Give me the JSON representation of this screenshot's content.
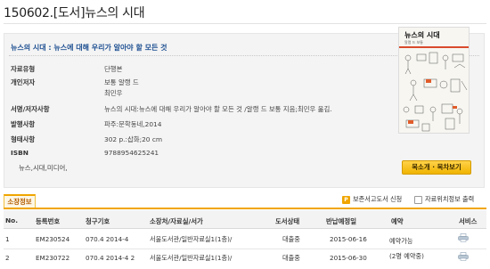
{
  "page_title": "150602.[도서]뉴스의 시대",
  "record": {
    "title": "뉴스의 시대 : 뉴스에 대해 우리가 알아야 할 모든 것",
    "fields": [
      {
        "label": "자료유형",
        "value": "단행본"
      },
      {
        "label": "개인저자",
        "value": "보통 알랭 드"
      },
      {
        "label": "",
        "value": "최민우"
      },
      {
        "label": "서명/저자사항",
        "value": "뉴스의 시대:뉴스에 대해 우리가 알아야 할 모든 것 /알랭 드 보통 지음;최민우 옮김."
      },
      {
        "label": "발행사항",
        "value": "파주:문학동네,2014"
      },
      {
        "label": "형태사항",
        "value": "302 p.:삽화;20 cm"
      },
      {
        "label": "ISBN",
        "value": "9788954625241"
      }
    ],
    "keywords": "뉴스,시대,미디어,",
    "cover": {
      "title": "뉴스의 시대",
      "subtitle": "알랭 드 보통"
    },
    "preview_button": "목소개 · 목차보기"
  },
  "holdings": {
    "tab_label": "소장정보",
    "tools": {
      "storage_request": "보존서고도서 신청",
      "location_print": "자료위치정보 출력"
    },
    "columns": [
      "No.",
      "등록번호",
      "청구기호",
      "소장처/자료실/서가",
      "도서상태",
      "반납예정일",
      "예약",
      "서비스"
    ],
    "rows": [
      {
        "no": "1",
        "reg": "EM230524",
        "call": "070.4 2014-4",
        "location": "서울도서관/일반자료실1(1층)/",
        "status": "대출중",
        "due": "2015-06-16",
        "reserve": "예약가능",
        "reserve2": ""
      },
      {
        "no": "2",
        "reg": "EM230722",
        "call": "070.4 2014-4 2",
        "location": "서울도서관/일반자료실1(1층)/",
        "status": "대출중",
        "due": "2015-06-30",
        "reserve": "",
        "reserve2": "(2명 예약중)"
      }
    ]
  },
  "colors": {
    "accent": "#f0a500",
    "title_blue": "#1d4f91"
  }
}
